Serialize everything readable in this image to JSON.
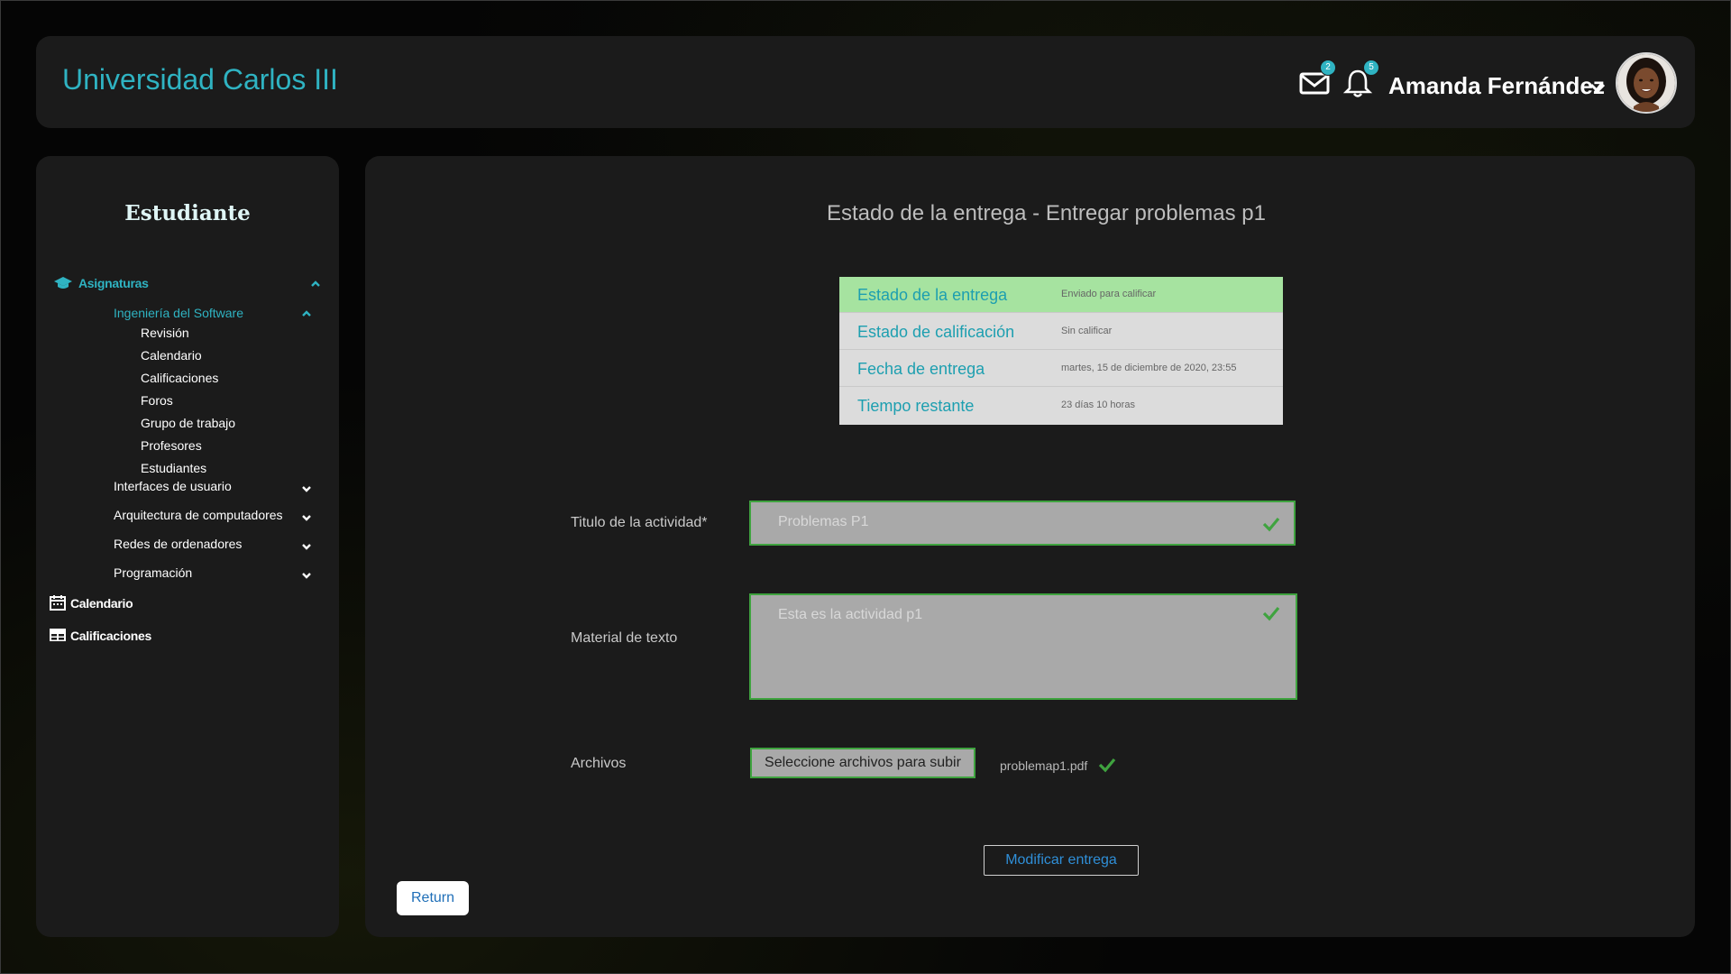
{
  "header": {
    "brand": "Universidad Carlos III",
    "mail_badge": "2",
    "bell_badge": "5",
    "user_name": "Amanda Fernández"
  },
  "sidebar": {
    "title": "Estudiante",
    "asignaturas": "Asignaturas",
    "current_course": "Ingeniería del Software",
    "course_items": [
      "Revisión",
      "Calendario",
      "Calificaciones",
      "Foros",
      "Grupo de trabajo",
      "Profesores",
      "Estudiantes"
    ],
    "other_courses": [
      "Interfaces de usuario",
      "Arquitectura de computadores",
      "Redes de ordenadores",
      "Programación"
    ],
    "calendario": "Calendario",
    "calificaciones": "Calificaciones"
  },
  "main": {
    "title": "Estado de la entrega - Entregar problemas p1",
    "status_rows": [
      {
        "label": "Estado de la entrega",
        "value": "Enviado para calificar"
      },
      {
        "label": "Estado de calificación",
        "value": "Sin calificar"
      },
      {
        "label": "Fecha de entrega",
        "value": "martes, 15 de diciembre de 2020, 23:55"
      },
      {
        "label": "Tiempo restante",
        "value": "23 días 10 horas"
      }
    ],
    "title_label": "Titulo de la actividad*",
    "title_value": "Problemas P1",
    "material_label": "Material de texto",
    "material_value": "Esta es la actividad p1",
    "files_label": "Archivos",
    "file_button": "Seleccione archivos para subir",
    "file_name": "problemap1.pdf",
    "modify_button": "Modificar entrega",
    "return_button": "Return"
  },
  "colors": {
    "accent": "#2fb3c2",
    "success_green": "#3fa33f",
    "status_highlight": "#a6e3a0"
  }
}
